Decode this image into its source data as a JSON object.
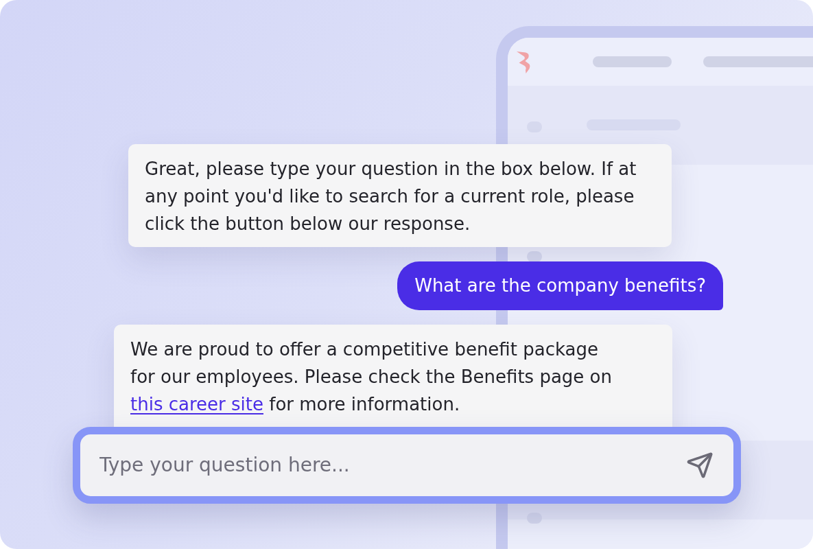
{
  "messages": [
    {
      "kind": "bot",
      "text": "Great, please type your question in the box below. If at any point you'd like to search for a current role, please click the button below our response."
    },
    {
      "kind": "user",
      "text": "What are the company benefits?"
    },
    {
      "kind": "bot",
      "segments": [
        {
          "kind": "text",
          "text": "We are proud to offer a competitive benefit package for our employees. Please check the Benefits page on "
        },
        {
          "kind": "link",
          "text": "this career site"
        },
        {
          "kind": "text",
          "text": " for more information."
        }
      ]
    }
  ],
  "composer": {
    "placeholder": "Type your question here..."
  }
}
